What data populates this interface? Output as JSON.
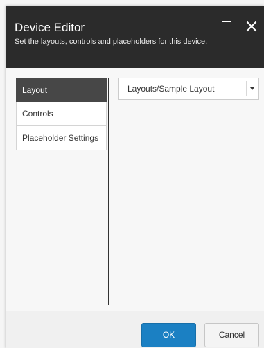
{
  "dialog": {
    "title": "Device Editor",
    "subtitle": "Set the layouts, controls and placeholders for this device.",
    "maximize_icon": "square-icon",
    "close_icon": "x-icon"
  },
  "nav": {
    "items": [
      {
        "label": "Layout",
        "active": true
      },
      {
        "label": "Controls",
        "active": false
      },
      {
        "label": "Placeholder Settings",
        "active": false
      }
    ]
  },
  "layout": {
    "selected_layout": "Layouts/Sample Layout"
  },
  "footer": {
    "ok_label": "OK",
    "cancel_label": "Cancel"
  },
  "colors": {
    "header_bg": "#2b2b2b",
    "nav_active_bg": "#474747",
    "primary_button": "#1b80c3"
  }
}
